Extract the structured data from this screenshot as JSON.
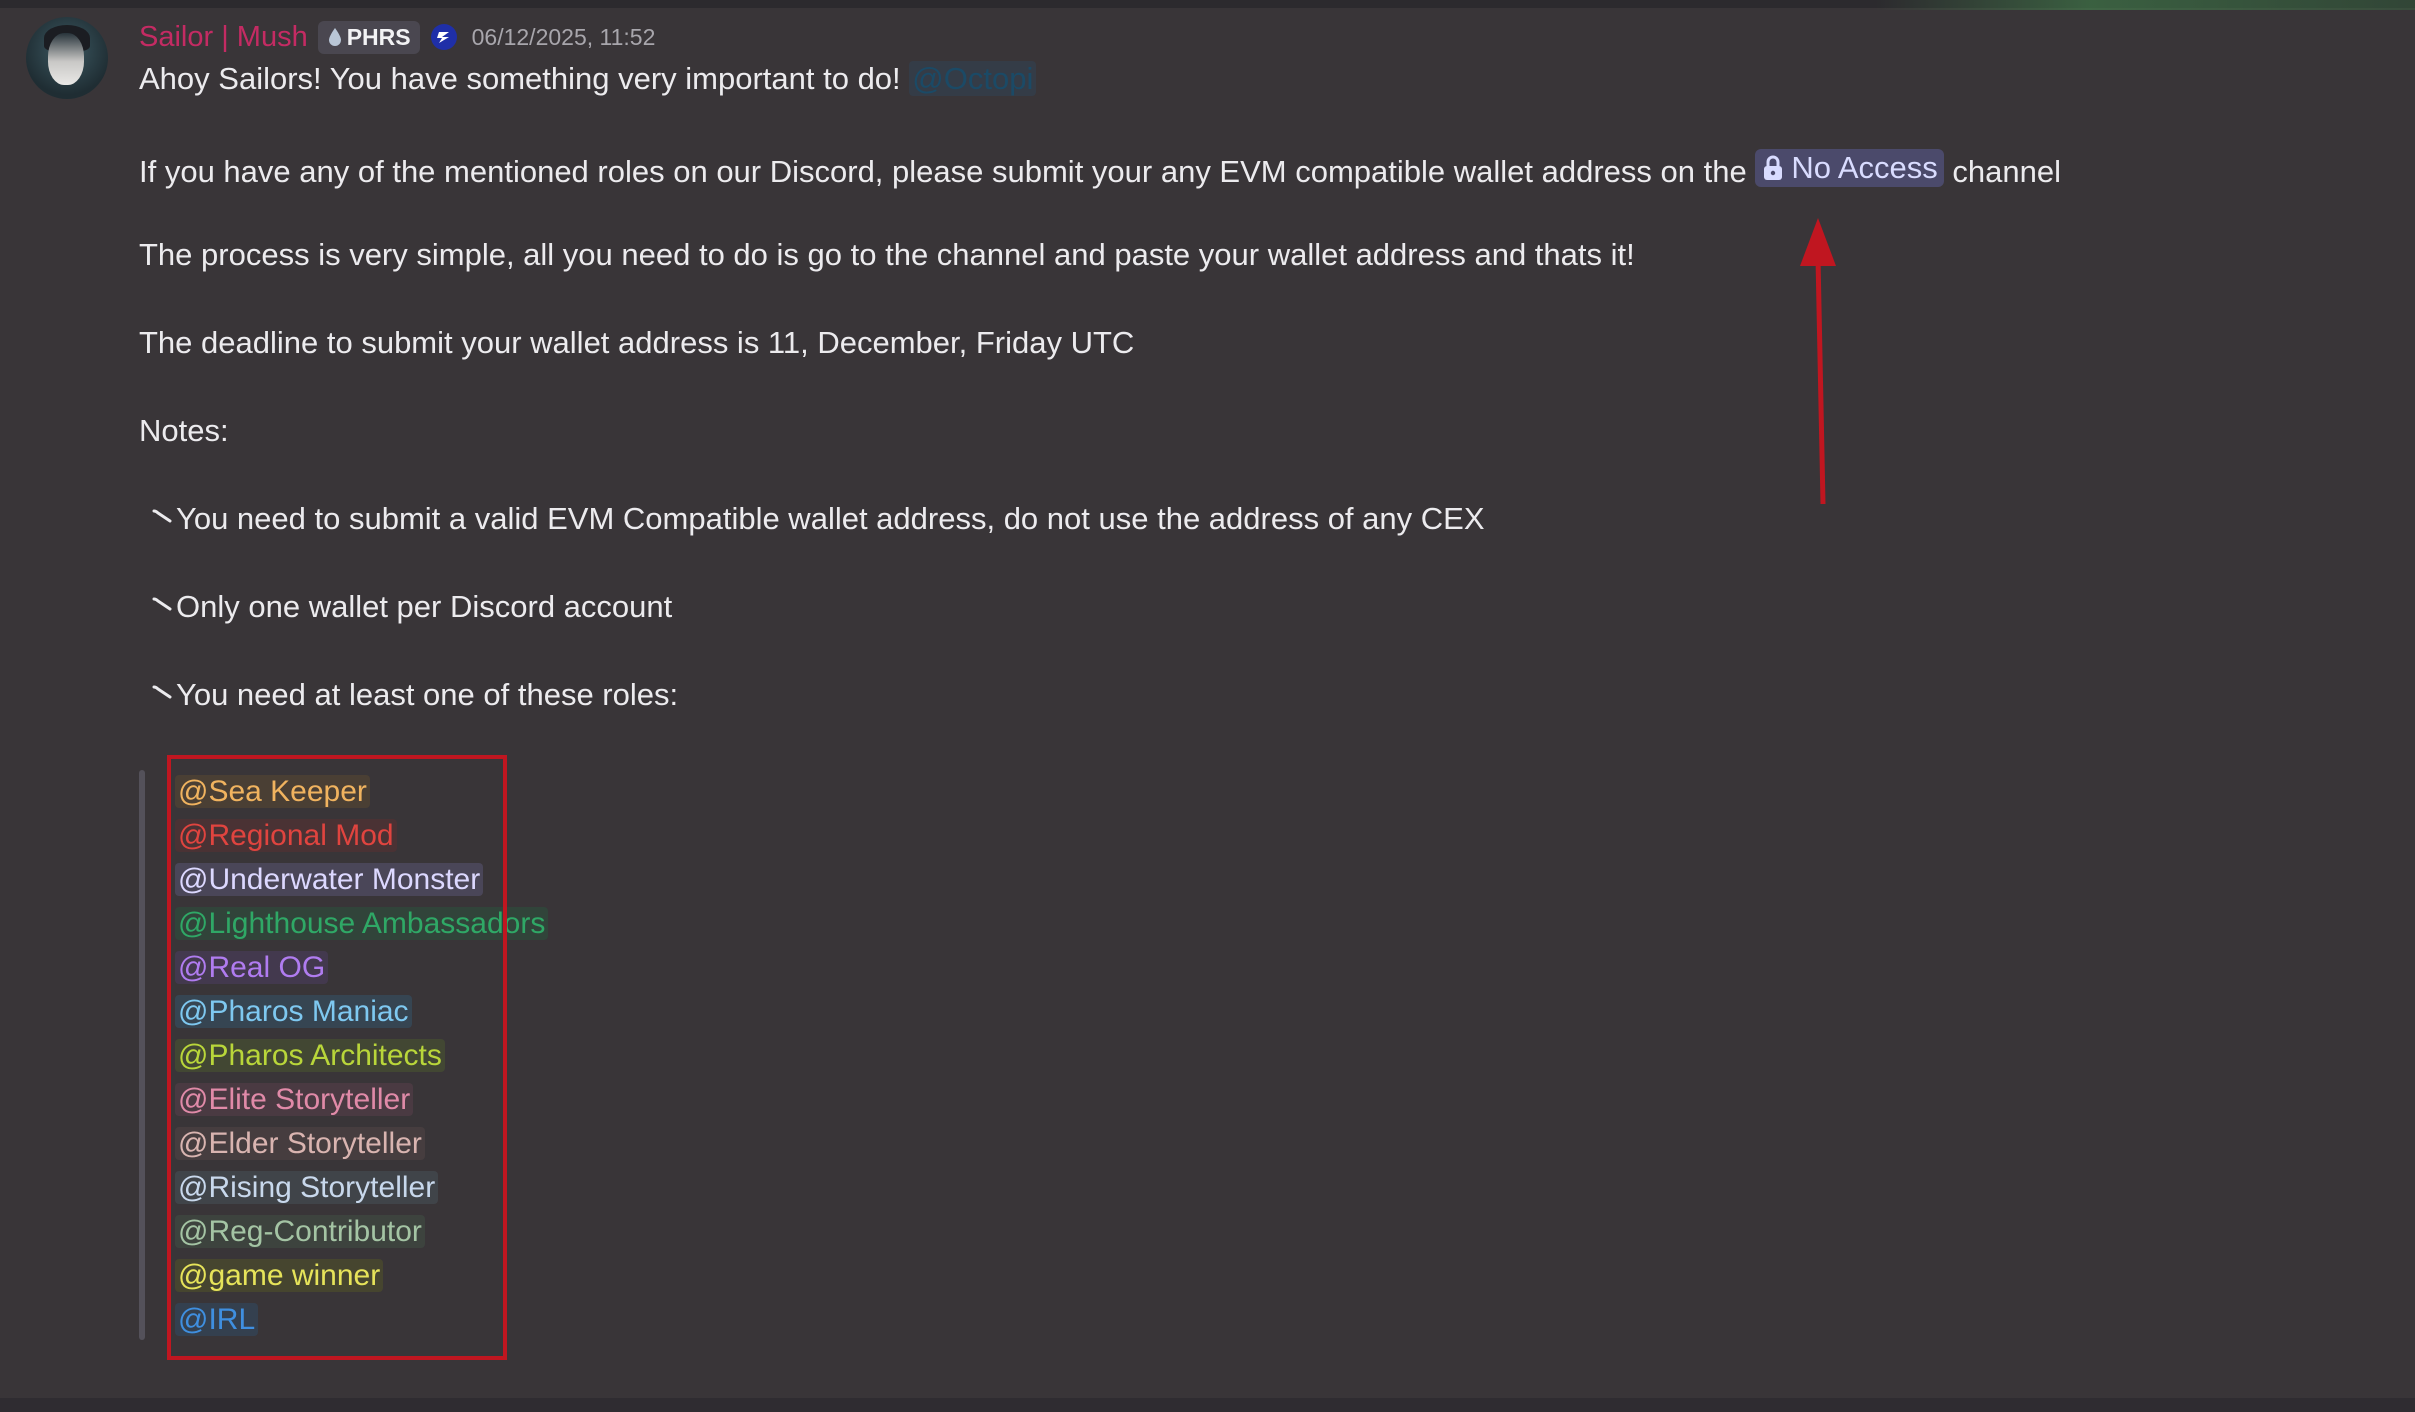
{
  "message": {
    "author": "Sailor | Mush",
    "server_tag": "PHRS",
    "timestamp": "06/12/2025, 11:52",
    "line1_text": "Ahoy Sailors! You have something very important to do!",
    "line1_mention": "@Octopi",
    "line2_before": "If you have any of the mentioned roles on our Discord, please submit your any EVM compatible wallet address on the",
    "line2_channel": "No Access",
    "line2_after": "channel",
    "line3": "The process is very simple, all you need to do is go to the channel and paste your wallet address and thats it!",
    "line4": "The deadline to submit your wallet address is 11, December, Friday UTC",
    "notes_label": "Notes:",
    "note1": "You need to submit a valid EVM Compatible wallet address, do not use the address of any CEX",
    "note2": "Only one wallet per Discord account",
    "note3": "You need at least one of these roles:"
  },
  "roles": [
    {
      "label": "@Sea Keeper",
      "color": "#f0b35f",
      "bg": "#4a3f34"
    },
    {
      "label": "@Regional Mod",
      "color": "#e0443f",
      "bg": "#4a3234"
    },
    {
      "label": "@Underwater Monster",
      "color": "#dcd8ff",
      "bg": "#4a4658"
    },
    {
      "label": "@Lighthouse Ambassadors",
      "color": "#2fa866",
      "bg": "#31443a"
    },
    {
      "label": "@Real OG",
      "color": "#b07cf0",
      "bg": "#43394e"
    },
    {
      "label": "@Pharos Maniac",
      "color": "#7ec8f0",
      "bg": "#364552"
    },
    {
      "label": "@Pharos Architects",
      "color": "#b9d63a",
      "bg": "#424733"
    },
    {
      "label": "@Elite Storyteller",
      "color": "#e08aa8",
      "bg": "#4a3a42"
    },
    {
      "label": "@Elder Storyteller",
      "color": "#d9b4b0",
      "bg": "#463d3f"
    },
    {
      "label": "@Rising Storyteller",
      "color": "#c8d8ec",
      "bg": "#404449"
    },
    {
      "label": "@Reg-Contributor",
      "color": "#a4c4a4",
      "bg": "#3d433e"
    },
    {
      "label": "@game winner",
      "color": "#e6e35a",
      "bg": "#46452f"
    },
    {
      "label": "@IRL",
      "color": "#3f8fe0",
      "bg": "#34404f"
    }
  ],
  "colors": {
    "background": "#393538",
    "author": "#c42b63",
    "highlight_box": "#c01620",
    "arrow": "#c01620"
  },
  "icons": [
    "avatar",
    "water-drop-icon",
    "server-badge-icon",
    "lock-icon",
    "reply-bullet-icon",
    "up-arrow-icon"
  ]
}
